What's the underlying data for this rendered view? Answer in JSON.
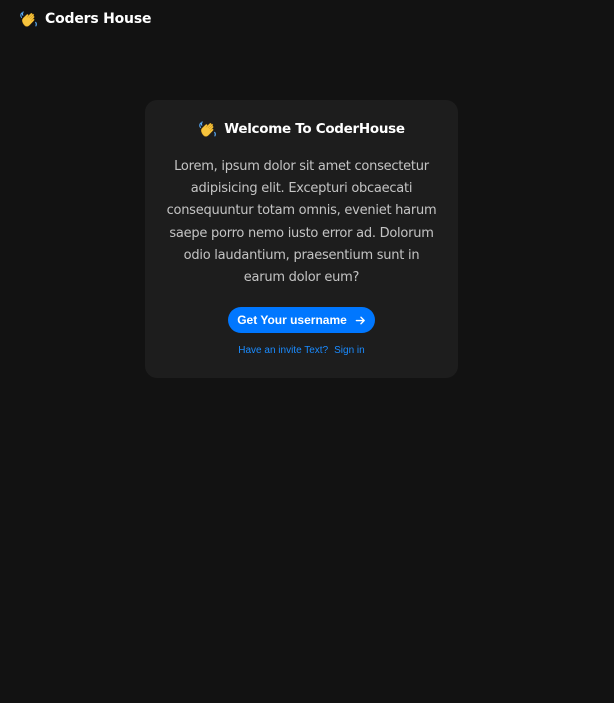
{
  "navbar": {
    "logo_icon": "waving-hand-icon",
    "logo_text": "Coders House"
  },
  "card": {
    "heading_icon": "waving-hand-icon",
    "title": "Welcome To CoderHouse",
    "body": "Lorem, ipsum dolor sit amet consectetur adipisicing elit. Excepturi obcaecati consequuntur totam omnis, eveniet harum saepe porro nemo iusto error ad. Dolorum odio laudantium, praesentium sunt in earum dolor eum?",
    "button_label": "Get Your username",
    "button_icon": "arrow-right-icon",
    "invite_text": "Have an invite Text?",
    "signin_label": "Sign in"
  },
  "colors": {
    "background": "#121212",
    "card": "#1d1d1d",
    "accent": "#0077ff",
    "link": "#1a8bff",
    "body_text": "#c4c4c4"
  }
}
